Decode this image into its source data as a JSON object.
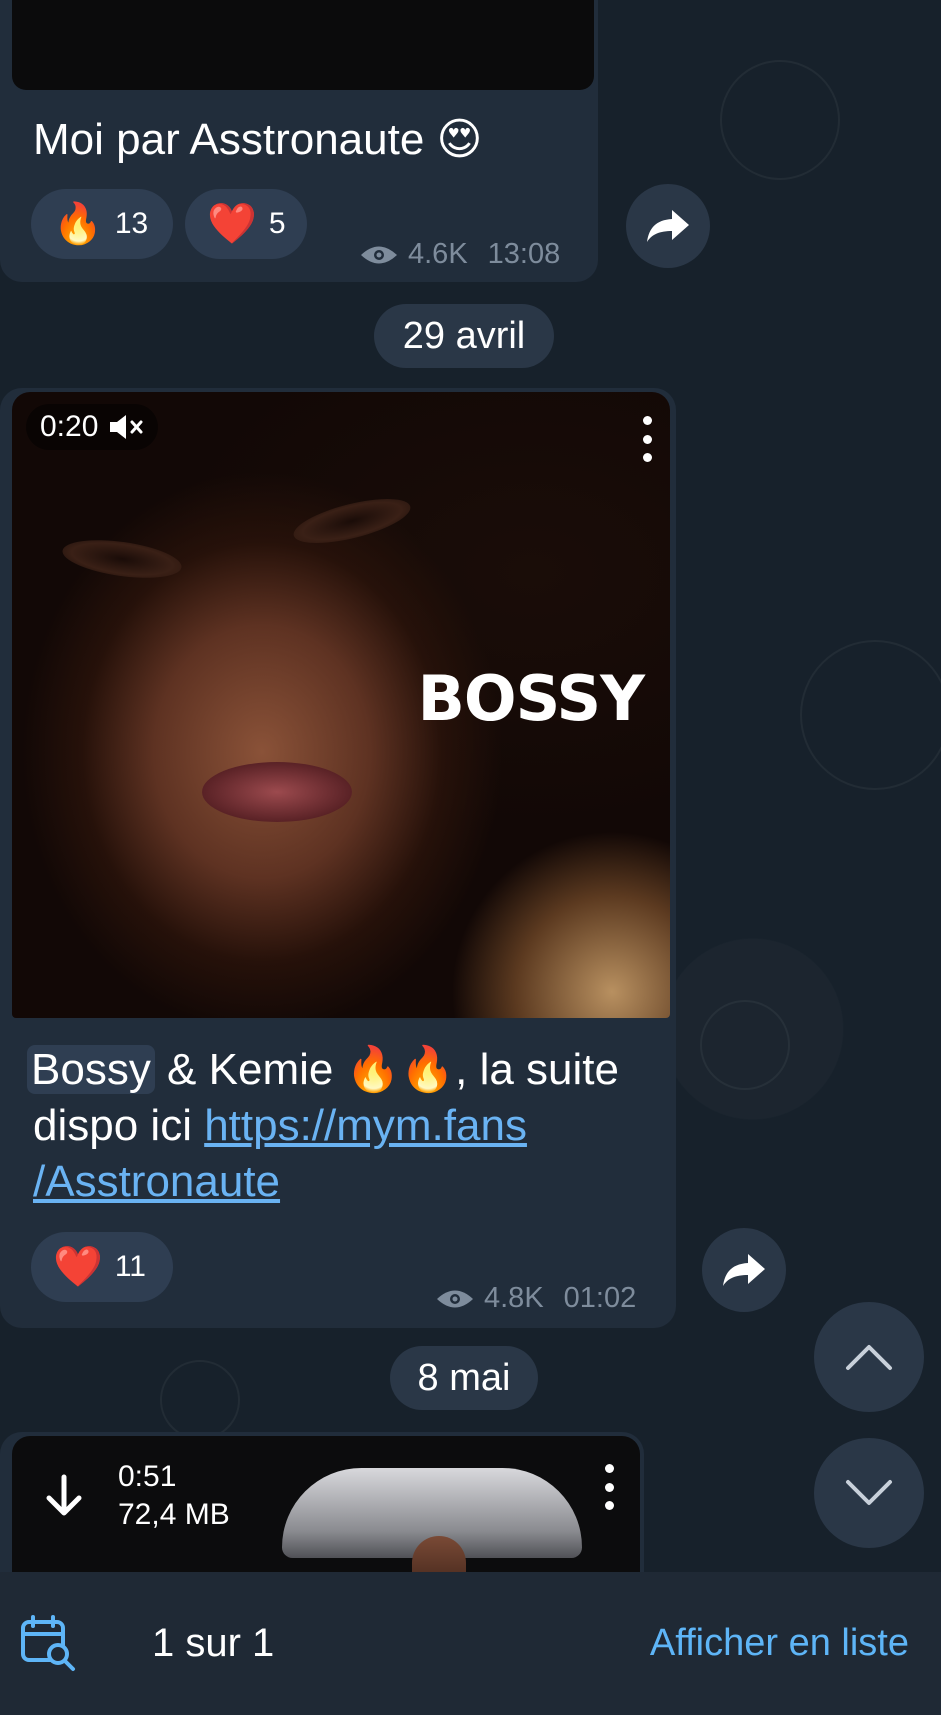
{
  "messages": [
    {
      "text": "Moi par Asstronaute 😍",
      "reactions": [
        {
          "emoji": "🔥",
          "count": "13"
        },
        {
          "emoji": "❤️",
          "count": "5"
        }
      ],
      "views": "4.6K",
      "time": "13:08"
    },
    {
      "video": {
        "duration": "0:20",
        "muted_icon": "speaker-muted-icon",
        "title_overlay": "BOSSY"
      },
      "text_highlight": "Bossy",
      "text_rest": " & Kemie 🔥🔥, la suite dispo ici ",
      "link": "https://mym.fans /Asstronaute",
      "reactions": [
        {
          "emoji": "❤️",
          "count": "11"
        }
      ],
      "views": "4.8K",
      "time": "01:02"
    },
    {
      "video": {
        "duration": "0:51",
        "size": "72,4 MB",
        "download_icon": "download-arrow-icon"
      }
    }
  ],
  "date_separators": [
    "29 avril",
    "8 mai"
  ],
  "bottom_bar": {
    "calendar_icon": "calendar-search-icon",
    "result_count": "1 sur 1",
    "list_view_label": "Afficher en liste"
  },
  "colors": {
    "background": "#17212b",
    "bubble": "#212d3b",
    "pill": "#2a3747",
    "link": "#6ab3f3",
    "accent": "#5eb5f7"
  }
}
